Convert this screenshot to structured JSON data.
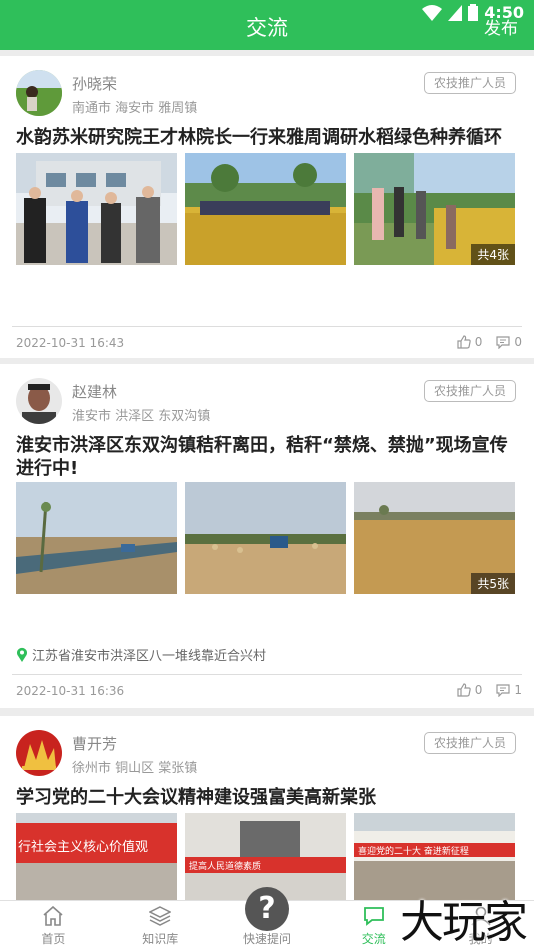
{
  "status_bar": {
    "time": "4:50"
  },
  "header": {
    "title": "交流",
    "publish_label": "发布"
  },
  "posts": [
    {
      "author": "孙晓荣",
      "location": "南通市 海安市 雅周镇",
      "role": "农技推广人员",
      "title": "水韵苏米研究院王才林院长一行来雅周调研水稻绿色种养循环",
      "photo_count": "共4张",
      "date": "2022-10-31 16:43",
      "likes": "0",
      "comments": "0"
    },
    {
      "author": "赵建林",
      "location": "淮安市 洪泽区 东双沟镇",
      "role": "农技推广人员",
      "title": "淮安市洪泽区东双沟镇秸秆离田，秸秆“禁烧、禁抛”现场宣传进行中!",
      "photo_count": "共5张",
      "address": "江苏省淮安市洪泽区八一堆线靠近合兴村",
      "date": "2022-10-31 16:36",
      "likes": "0",
      "comments": "1"
    },
    {
      "author": "曹开芳",
      "location": "徐州市 铜山区 棠张镇",
      "role": "农技推广人员",
      "title": "学习党的二十大会议精神建设强富美高新棠张",
      "photo_banners": [
        "行社会主义核心价值观",
        "提高人民道德素质",
        "喜迎党的二十大 奋进新征程"
      ]
    }
  ],
  "tabbar": {
    "items": [
      {
        "label": "首页",
        "icon": "home-icon"
      },
      {
        "label": "知识库",
        "icon": "layers-icon"
      },
      {
        "label": "快速提问",
        "icon": "question-icon"
      },
      {
        "label": "交流",
        "icon": "chat-icon"
      },
      {
        "label": "我的",
        "icon": "user-icon"
      }
    ],
    "active_index": 3
  },
  "watermark": "大玩家",
  "colors": {
    "accent": "#2fbf5a",
    "location_pin": "#2fbf5a"
  }
}
